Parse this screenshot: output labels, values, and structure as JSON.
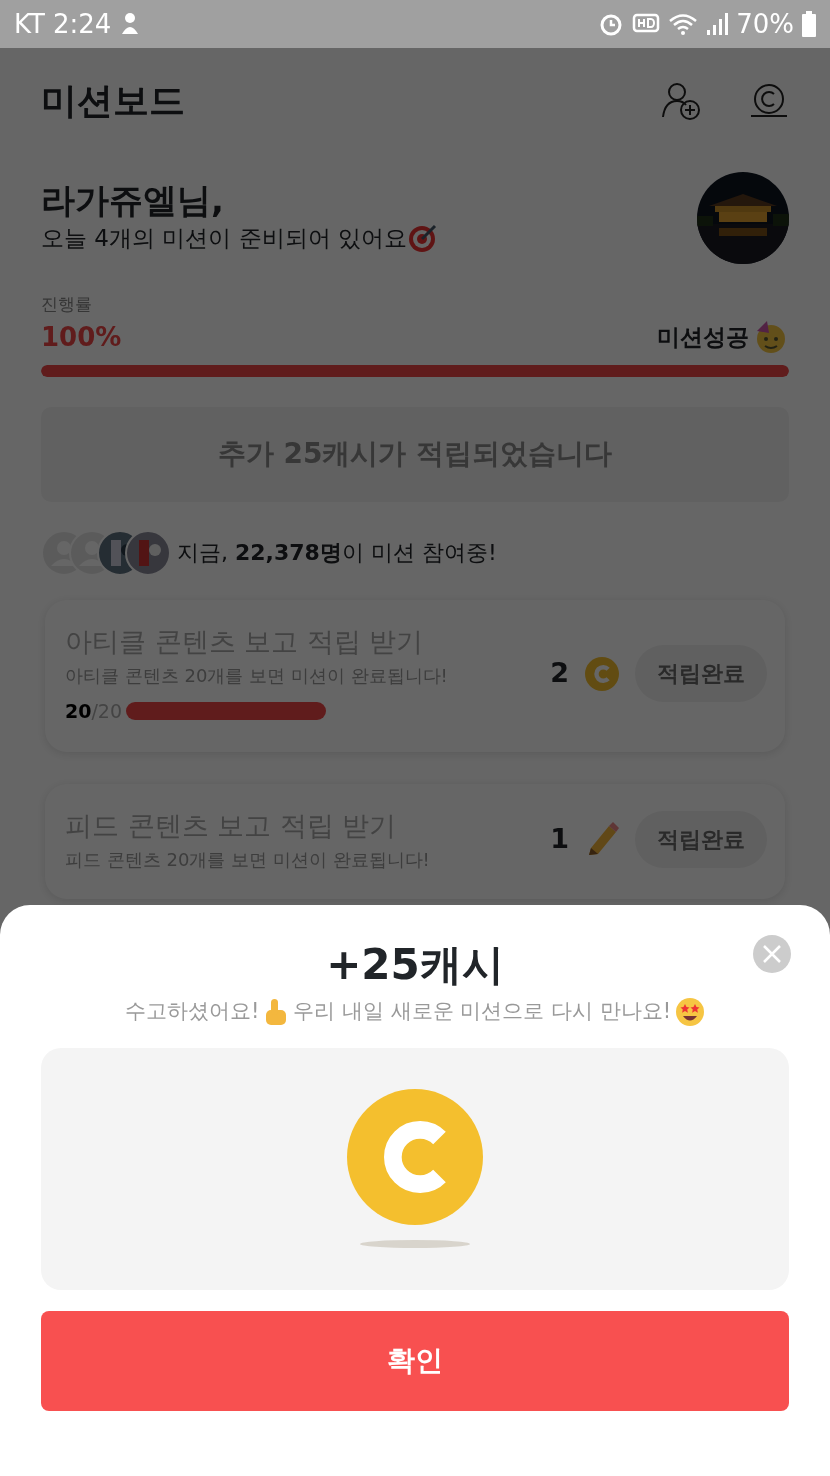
{
  "status_bar": {
    "carrier": "KT",
    "time": "2:24",
    "battery": "70%"
  },
  "header": {
    "title": "미션보드"
  },
  "greeting": {
    "name": "라가쥬엘님,",
    "message": "오늘 4개의 미션이 준비되어 있어요"
  },
  "progress": {
    "label": "진행률",
    "percent": "100%",
    "status": "미션성공",
    "level": 1
  },
  "bonus_banner": {
    "text": "추가 25캐시가 적립되었습니다"
  },
  "participants": {
    "text": "지금, **22,378명**이 미션 참여중!",
    "avatars": [
      {
        "kind": "silhouette"
      },
      {
        "kind": "silhouette"
      },
      {
        "kind": "picture"
      },
      {
        "kind": "picture"
      }
    ]
  },
  "missions": [
    {
      "title": "아티클 콘텐츠 보고 적립 받기",
      "description": "아티클 콘텐츠 20개를 보면 미션이 완료됩니다!",
      "count_done": "20",
      "count_total": "/20",
      "level": 1,
      "reward": "2",
      "kind": "coin",
      "button": "적립완료",
      "disabled": true
    },
    {
      "title": "피드 콘텐츠 보고 적립 받기",
      "description": "피드 콘텐츠 20개를 보면 미션이 완료됩니다!",
      "reward": "1",
      "kind": "pencil",
      "button": "적립완료",
      "disabled": true
    }
  ],
  "modal": {
    "title": "+25캐시",
    "message_parts": [
      "수고하셨어요!",
      "우리 내일 새로운 미션으로 다시 만나요!"
    ],
    "confirm": "확인"
  }
}
